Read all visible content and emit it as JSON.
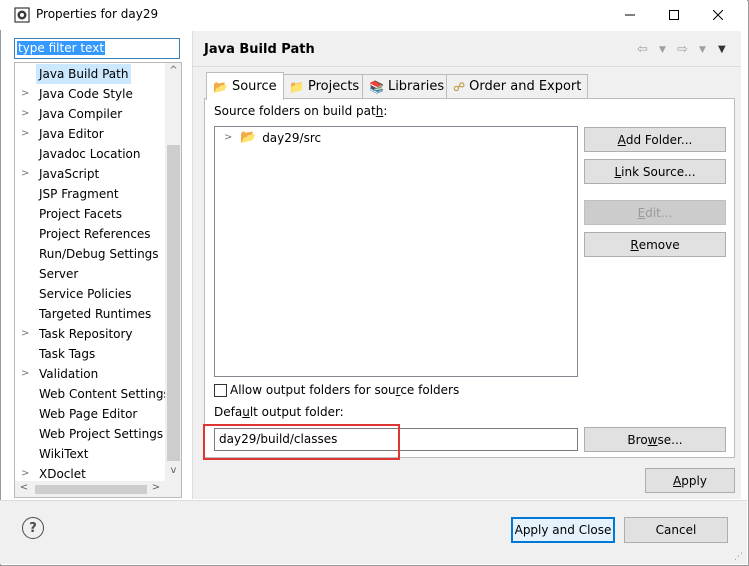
{
  "window": {
    "title": "Properties for day29"
  },
  "filter": {
    "placeholder": "type filter text"
  },
  "tree": {
    "items": [
      {
        "label": "Java Build Path",
        "expandable": false
      },
      {
        "label": "Java Code Style",
        "expandable": true
      },
      {
        "label": "Java Compiler",
        "expandable": true
      },
      {
        "label": "Java Editor",
        "expandable": true
      },
      {
        "label": "Javadoc Location",
        "expandable": false
      },
      {
        "label": "JavaScript",
        "expandable": true
      },
      {
        "label": "JSP Fragment",
        "expandable": false
      },
      {
        "label": "Project Facets",
        "expandable": false
      },
      {
        "label": "Project References",
        "expandable": false
      },
      {
        "label": "Run/Debug Settings",
        "expandable": false
      },
      {
        "label": "Server",
        "expandable": false
      },
      {
        "label": "Service Policies",
        "expandable": false
      },
      {
        "label": "Targeted Runtimes",
        "expandable": false
      },
      {
        "label": "Task Repository",
        "expandable": true
      },
      {
        "label": "Task Tags",
        "expandable": false
      },
      {
        "label": "Validation",
        "expandable": true
      },
      {
        "label": "Web Content Settings",
        "expandable": false
      },
      {
        "label": "Web Page Editor",
        "expandable": false
      },
      {
        "label": "Web Project Settings",
        "expandable": false
      },
      {
        "label": "WikiText",
        "expandable": false
      },
      {
        "label": "XDoclet",
        "expandable": true
      }
    ]
  },
  "page": {
    "title": "Java Build Path"
  },
  "tabs": {
    "source": "Source",
    "projects": "Projects",
    "libraries": "Libraries",
    "order": "Order and Export"
  },
  "source_tab": {
    "folders_label": "Source folders on build path:",
    "folder_item": "day29/src",
    "allow_label": "Allow output folders for source folders",
    "allow_checked": false,
    "output_label": "Default output folder:",
    "output_value": "day29/build/classes"
  },
  "buttons": {
    "add_folder": "Add Folder...",
    "link_source": "Link Source...",
    "edit": "Edit...",
    "remove": "Remove",
    "browse": "Browse...",
    "apply": "Apply",
    "apply_close": "Apply and Close",
    "cancel": "Cancel"
  },
  "colors": {
    "selection": "#cce8ff",
    "highlight_box": "#e03535",
    "default_button": "#0078d7"
  }
}
